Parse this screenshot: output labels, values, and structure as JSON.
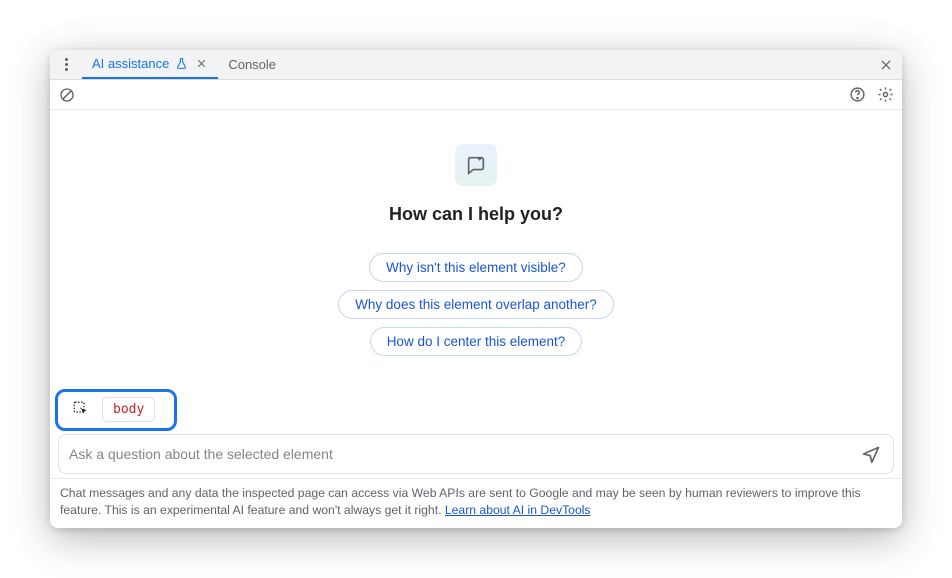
{
  "tabs": {
    "active": "AI assistance",
    "inactive": "Console"
  },
  "content": {
    "heading": "How can I help you?",
    "suggestions": [
      "Why isn't this element visible?",
      "Why does this element overlap another?",
      "How do I center this element?"
    ]
  },
  "context": {
    "selected_element": "body"
  },
  "input": {
    "placeholder": "Ask a question about the selected element"
  },
  "disclaimer": {
    "text": "Chat messages and any data the inspected page can access via Web APIs are sent to Google and may be seen by human reviewers to improve this feature. This is an experimental AI feature and won't always get it right. ",
    "link_text": "Learn about AI in DevTools"
  }
}
